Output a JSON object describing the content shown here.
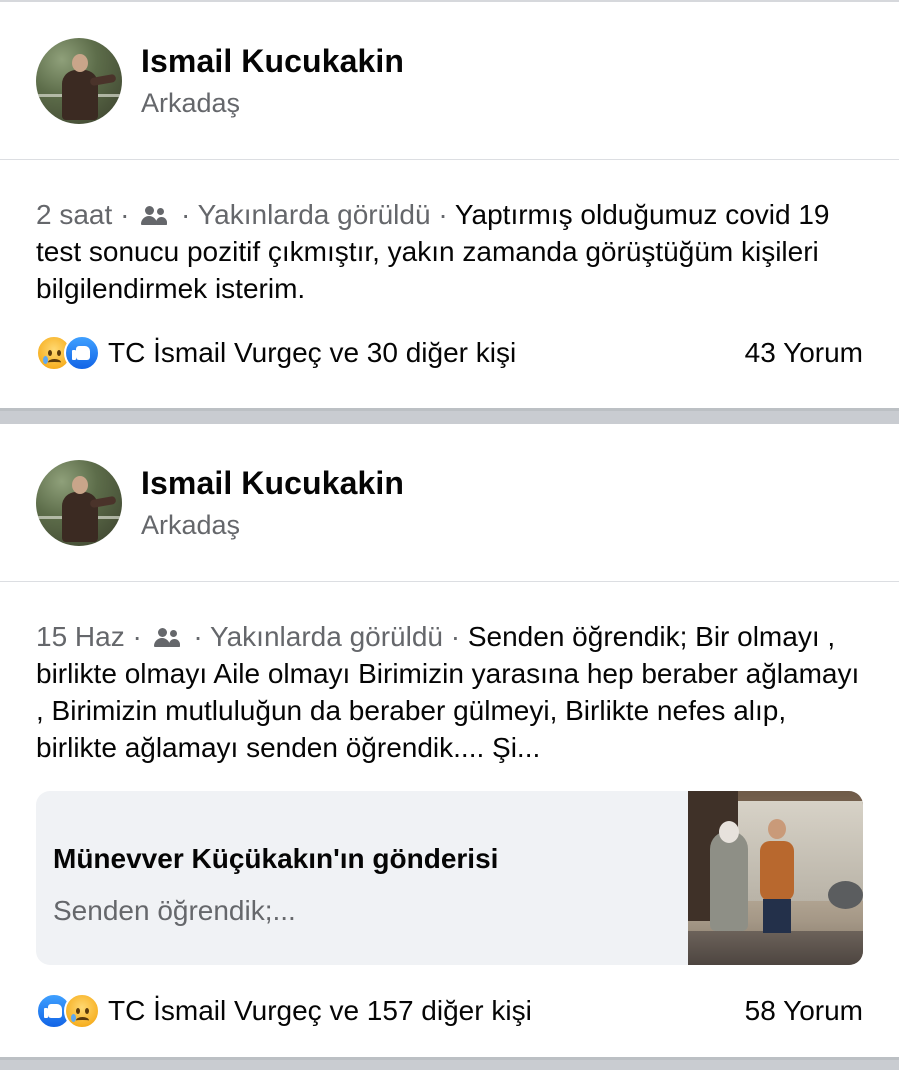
{
  "posts": [
    {
      "author": "Ismail Kucukakin",
      "relation": "Arkadaş",
      "time": "2 saat",
      "seen": "Yakınlarda görüldü",
      "text": "Yaptırmış olduğumuz covid 19 test sonucu pozitif çıkmıştır, yakın zamanda görüştüğüm kişileri bilgilendirmek isterim.",
      "reactions_text": "TC İsmail Vurgeç ve 30 diğer kişi",
      "reaction_icons": [
        "sad-reaction-icon",
        "like-reaction-icon"
      ],
      "comments": "43 Yorum"
    },
    {
      "author": "Ismail Kucukakin",
      "relation": "Arkadaş",
      "time": "15 Haz",
      "seen": "Yakınlarda görüldü",
      "text": "Senden öğrendik; Bir olmayı , birlikte olmayı Aile olmayı Birimizin yarasına hep beraber ağlamayı , Birimizin mutluluğun da beraber gülmeyi, Birlikte nefes alıp, birlikte ağlamayı senden öğrendik.... Şi...",
      "shared": {
        "title": "Münevver Küçükakın'ın gönderisi",
        "subtitle": "Senden öğrendik;..."
      },
      "reactions_text": "TC İsmail Vurgeç ve 157 diğer kişi",
      "reaction_icons": [
        "like-reaction-icon",
        "sad-reaction-icon"
      ],
      "comments": "58 Yorum"
    }
  ],
  "separator": "·",
  "colors": {
    "primary_text": "#050505",
    "secondary_text": "#65676b",
    "like_blue": "#1877f2",
    "card_bg": "#f0f2f5"
  }
}
